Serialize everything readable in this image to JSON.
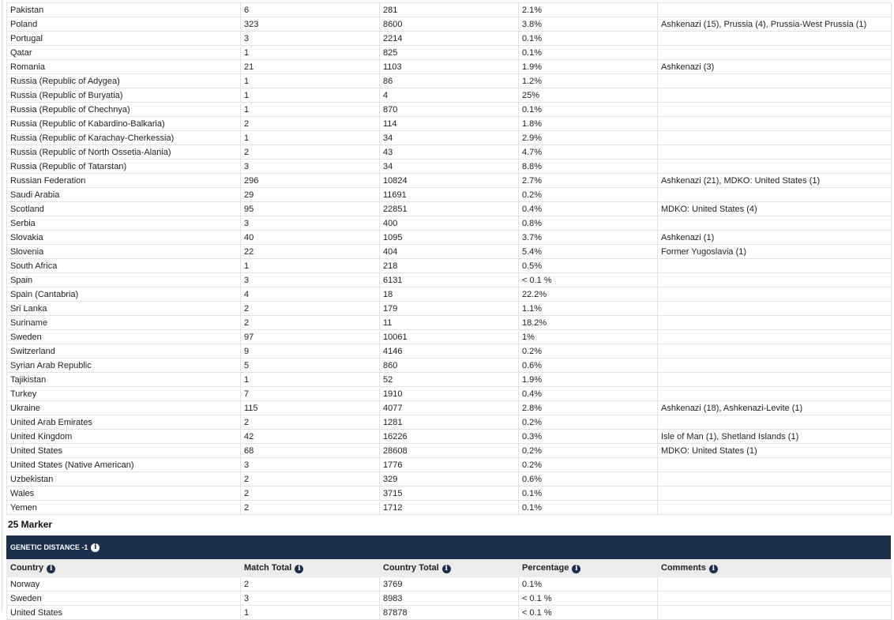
{
  "table1": {
    "rows": [
      [
        "Pakistan",
        "6",
        "281",
        "2.1%",
        ""
      ],
      [
        "Poland",
        "323",
        "8600",
        "3.8%",
        "Ashkenazi (15), Prussia (4), Prussia-West Prussia (1)"
      ],
      [
        "Portugal",
        "3",
        "2214",
        "0.1%",
        ""
      ],
      [
        "Qatar",
        "1",
        "825",
        "0.1%",
        ""
      ],
      [
        "Romania",
        "21",
        "1103",
        "1.9%",
        "Ashkenazi (3)"
      ],
      [
        "Russia (Republic of Adygea)",
        "1",
        "86",
        "1.2%",
        ""
      ],
      [
        "Russia (Republic of Buryatia)",
        "1",
        "4",
        "25%",
        ""
      ],
      [
        "Russia (Republic of Chechnya)",
        "1",
        "870",
        "0.1%",
        ""
      ],
      [
        "Russia (Republic of Kabardino-Balkaria)",
        "2",
        "114",
        "1.8%",
        ""
      ],
      [
        "Russia (Republic of Karachay-Cherkessia)",
        "1",
        "34",
        "2.9%",
        ""
      ],
      [
        "Russia (Republic of North Ossetia-Alania)",
        "2",
        "43",
        "4.7%",
        ""
      ],
      [
        "Russia (Republic of Tatarstan)",
        "3",
        "34",
        "8.8%",
        ""
      ],
      [
        "Russian Federation",
        "296",
        "10824",
        "2.7%",
        "Ashkenazi (21), MDKO: United States (1)"
      ],
      [
        "Saudi Arabia",
        "29",
        "11691",
        "0.2%",
        ""
      ],
      [
        "Scotland",
        "95",
        "22851",
        "0.4%",
        "MDKO: United States (4)"
      ],
      [
        "Serbia",
        "3",
        "400",
        "0.8%",
        ""
      ],
      [
        "Slovakia",
        "40",
        "1095",
        "3.7%",
        "Ashkenazi (1)"
      ],
      [
        "Slovenia",
        "22",
        "404",
        "5.4%",
        "Former Yugoslavia (1)"
      ],
      [
        "South Africa",
        "1",
        "218",
        "0.5%",
        ""
      ],
      [
        "Spain",
        "3",
        "6131",
        "< 0.1 %",
        ""
      ],
      [
        "Spain (Cantabria)",
        "4",
        "18",
        "22.2%",
        ""
      ],
      [
        "Sri Lanka",
        "2",
        "179",
        "1.1%",
        ""
      ],
      [
        "Suriname",
        "2",
        "11",
        "18.2%",
        ""
      ],
      [
        "Sweden",
        "97",
        "10061",
        "1%",
        ""
      ],
      [
        "Switzerland",
        "9",
        "4146",
        "0.2%",
        ""
      ],
      [
        "Syrian Arab Republic",
        "5",
        "860",
        "0.6%",
        ""
      ],
      [
        "Tajikistan",
        "1",
        "52",
        "1.9%",
        ""
      ],
      [
        "Turkey",
        "7",
        "1910",
        "0.4%",
        ""
      ],
      [
        "Ukraine",
        "115",
        "4077",
        "2.8%",
        "Ashkenazi (18), Ashkenazi-Levite (1)"
      ],
      [
        "United Arab Emirates",
        "2",
        "1281",
        "0.2%",
        ""
      ],
      [
        "United Kingdom",
        "42",
        "16226",
        "0.3%",
        "Isle of Man (1), Shetland Islands (1)"
      ],
      [
        "United States",
        "68",
        "28608",
        "0.2%",
        "MDKO: United States (1)"
      ],
      [
        "United States (Native American)",
        "3",
        "1776",
        "0.2%",
        ""
      ],
      [
        "Uzbekistan",
        "2",
        "329",
        "0.6%",
        ""
      ],
      [
        "Wales",
        "2",
        "3715",
        "0.1%",
        ""
      ],
      [
        "Yemen",
        "2",
        "1712",
        "0.1%",
        ""
      ]
    ]
  },
  "marker_heading": "25 Marker",
  "section": {
    "title": "GENETIC DISTANCE -1",
    "info_icon": "i",
    "headers": [
      "Country",
      "Match Total",
      "Country Total",
      "Percentage",
      "Comments"
    ],
    "rows": [
      [
        "Norway",
        "2",
        "3769",
        "0.1%",
        ""
      ],
      [
        "Sweden",
        "3",
        "8983",
        "< 0.1 %",
        ""
      ],
      [
        "United States",
        "1",
        "87878",
        "< 0.1 %",
        ""
      ]
    ]
  },
  "colors": {
    "header_bar": "#1c2f4d",
    "column_header_bg": "#ececec",
    "border": "#e2e2e2"
  }
}
